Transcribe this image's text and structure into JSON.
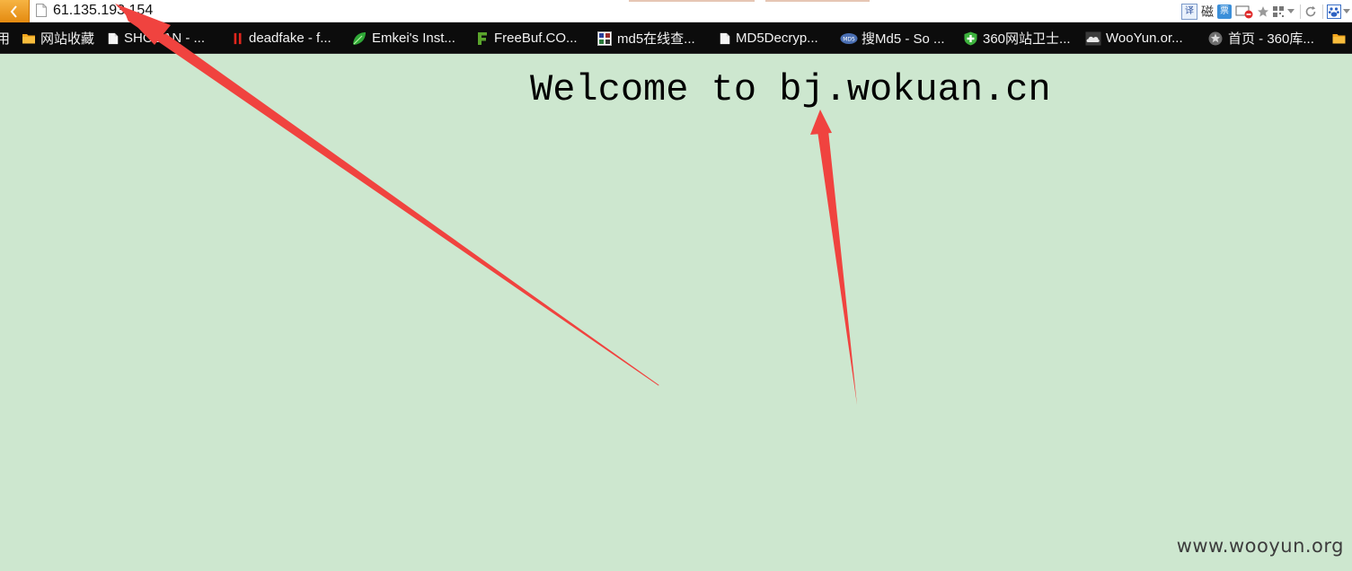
{
  "colors": {
    "page_background": "#cde7cf",
    "bookmarks_background": "#0c0c0c",
    "back_button": "#f0a02a",
    "annotation_arrow": "#f0433f"
  },
  "address_bar": {
    "url": "61.135.193.154",
    "back_icon": "chevron-left-icon",
    "page_icon": "blank-page-icon",
    "tools": {
      "translate_label": "译",
      "magnet_label": "磁",
      "ticket_label": "票"
    }
  },
  "bookmarks": [
    {
      "label": "用",
      "icon": "apps-icon",
      "color": "#e8e8e8"
    },
    {
      "label": "网站收藏",
      "icon": "folder-icon",
      "color": "#f3a51d"
    },
    {
      "label": "SHODAN - ...",
      "icon": "page-icon",
      "color": "#ffffff"
    },
    {
      "label": "deadfake - f...",
      "icon": "double-bar-icon",
      "color": "#e0261d"
    },
    {
      "label": "Emkei's Inst...",
      "icon": "leaf-icon",
      "color": "#2fa837"
    },
    {
      "label": "FreeBuf.CO...",
      "icon": "f-logo-icon",
      "color": "#5aa52c"
    },
    {
      "label": "md5在线查...",
      "icon": "grid-icon",
      "color": "#d0d0ff"
    },
    {
      "label": "MD5Decryp...",
      "icon": "page-icon",
      "color": "#ffffff"
    },
    {
      "label": "搜Md5 - So ...",
      "icon": "md5-badge-icon",
      "color": "#4a6fb3"
    },
    {
      "label": "360网站卫士...",
      "icon": "shield-icon",
      "color": "#3db23d"
    },
    {
      "label": "WooYun.or...",
      "icon": "cloud-icon",
      "color": "#cfcfcf"
    },
    {
      "label": "首页 - 360库...",
      "icon": "star-badge-icon",
      "color": "#bdbdbd"
    },
    {
      "label": "",
      "icon": "folder-icon",
      "color": "#f3a51d"
    }
  ],
  "page": {
    "welcome_text": "Welcome to bj.wokuan.cn",
    "watermark": "www.wooyun.org"
  }
}
